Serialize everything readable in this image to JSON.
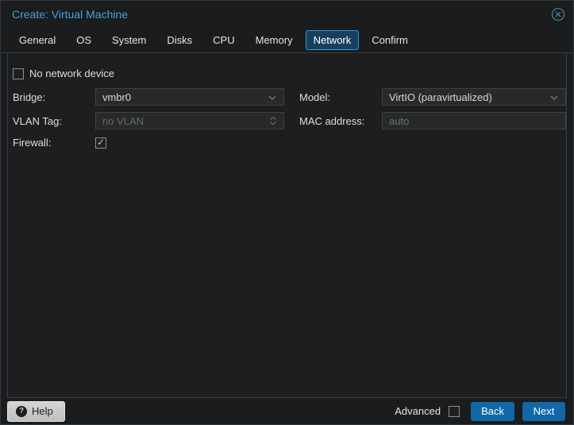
{
  "window": {
    "title": "Create: Virtual Machine"
  },
  "tabs": [
    {
      "label": "General",
      "active": false
    },
    {
      "label": "OS",
      "active": false
    },
    {
      "label": "System",
      "active": false
    },
    {
      "label": "Disks",
      "active": false
    },
    {
      "label": "CPU",
      "active": false
    },
    {
      "label": "Memory",
      "active": false
    },
    {
      "label": "Network",
      "active": true
    },
    {
      "label": "Confirm",
      "active": false
    }
  ],
  "form": {
    "no_network_label": "No network device",
    "no_network_checked": false,
    "bridge_label": "Bridge:",
    "bridge_value": "vmbr0",
    "vlan_label": "VLAN Tag:",
    "vlan_value": "no VLAN",
    "vlan_disabled": true,
    "firewall_label": "Firewall:",
    "firewall_checked": true,
    "model_label": "Model:",
    "model_value": "VirtIO (paravirtualized)",
    "mac_label": "MAC address:",
    "mac_placeholder": "auto"
  },
  "footer": {
    "help_label": "Help",
    "advanced_label": "Advanced",
    "advanced_checked": false,
    "back_label": "Back",
    "next_label": "Next"
  },
  "colors": {
    "title_blue": "#45a2dc",
    "active_tab_border": "#2e9ade",
    "active_tab_bg": "#17405f",
    "button_blue": "#1168a8",
    "panel_bg": "#1c1e1f",
    "field_bg": "#27292a"
  }
}
